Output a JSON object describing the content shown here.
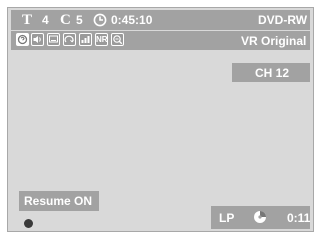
{
  "osd": {
    "title_letter": "T",
    "title_number": "4",
    "chapter_letter": "C",
    "chapter_number": "5",
    "elapsed_time": "0:45:10",
    "disc_type": "DVD-RW",
    "disc_format": "VR Original",
    "chapter_label": "CH 12",
    "resume_status": "Resume ON",
    "record_mode": "LP",
    "remaining_time": "0:11",
    "noise_reduction_label": "NR",
    "icons": [
      "help-icon",
      "audio-icon",
      "subtitle-icon",
      "angle-icon",
      "bookmark-icon",
      "noise-reduction-icon",
      "zoom-icon"
    ],
    "colors": {
      "bar": "#a2a2a2",
      "screen": "#d9d9d9",
      "text": "#ffffff"
    }
  }
}
